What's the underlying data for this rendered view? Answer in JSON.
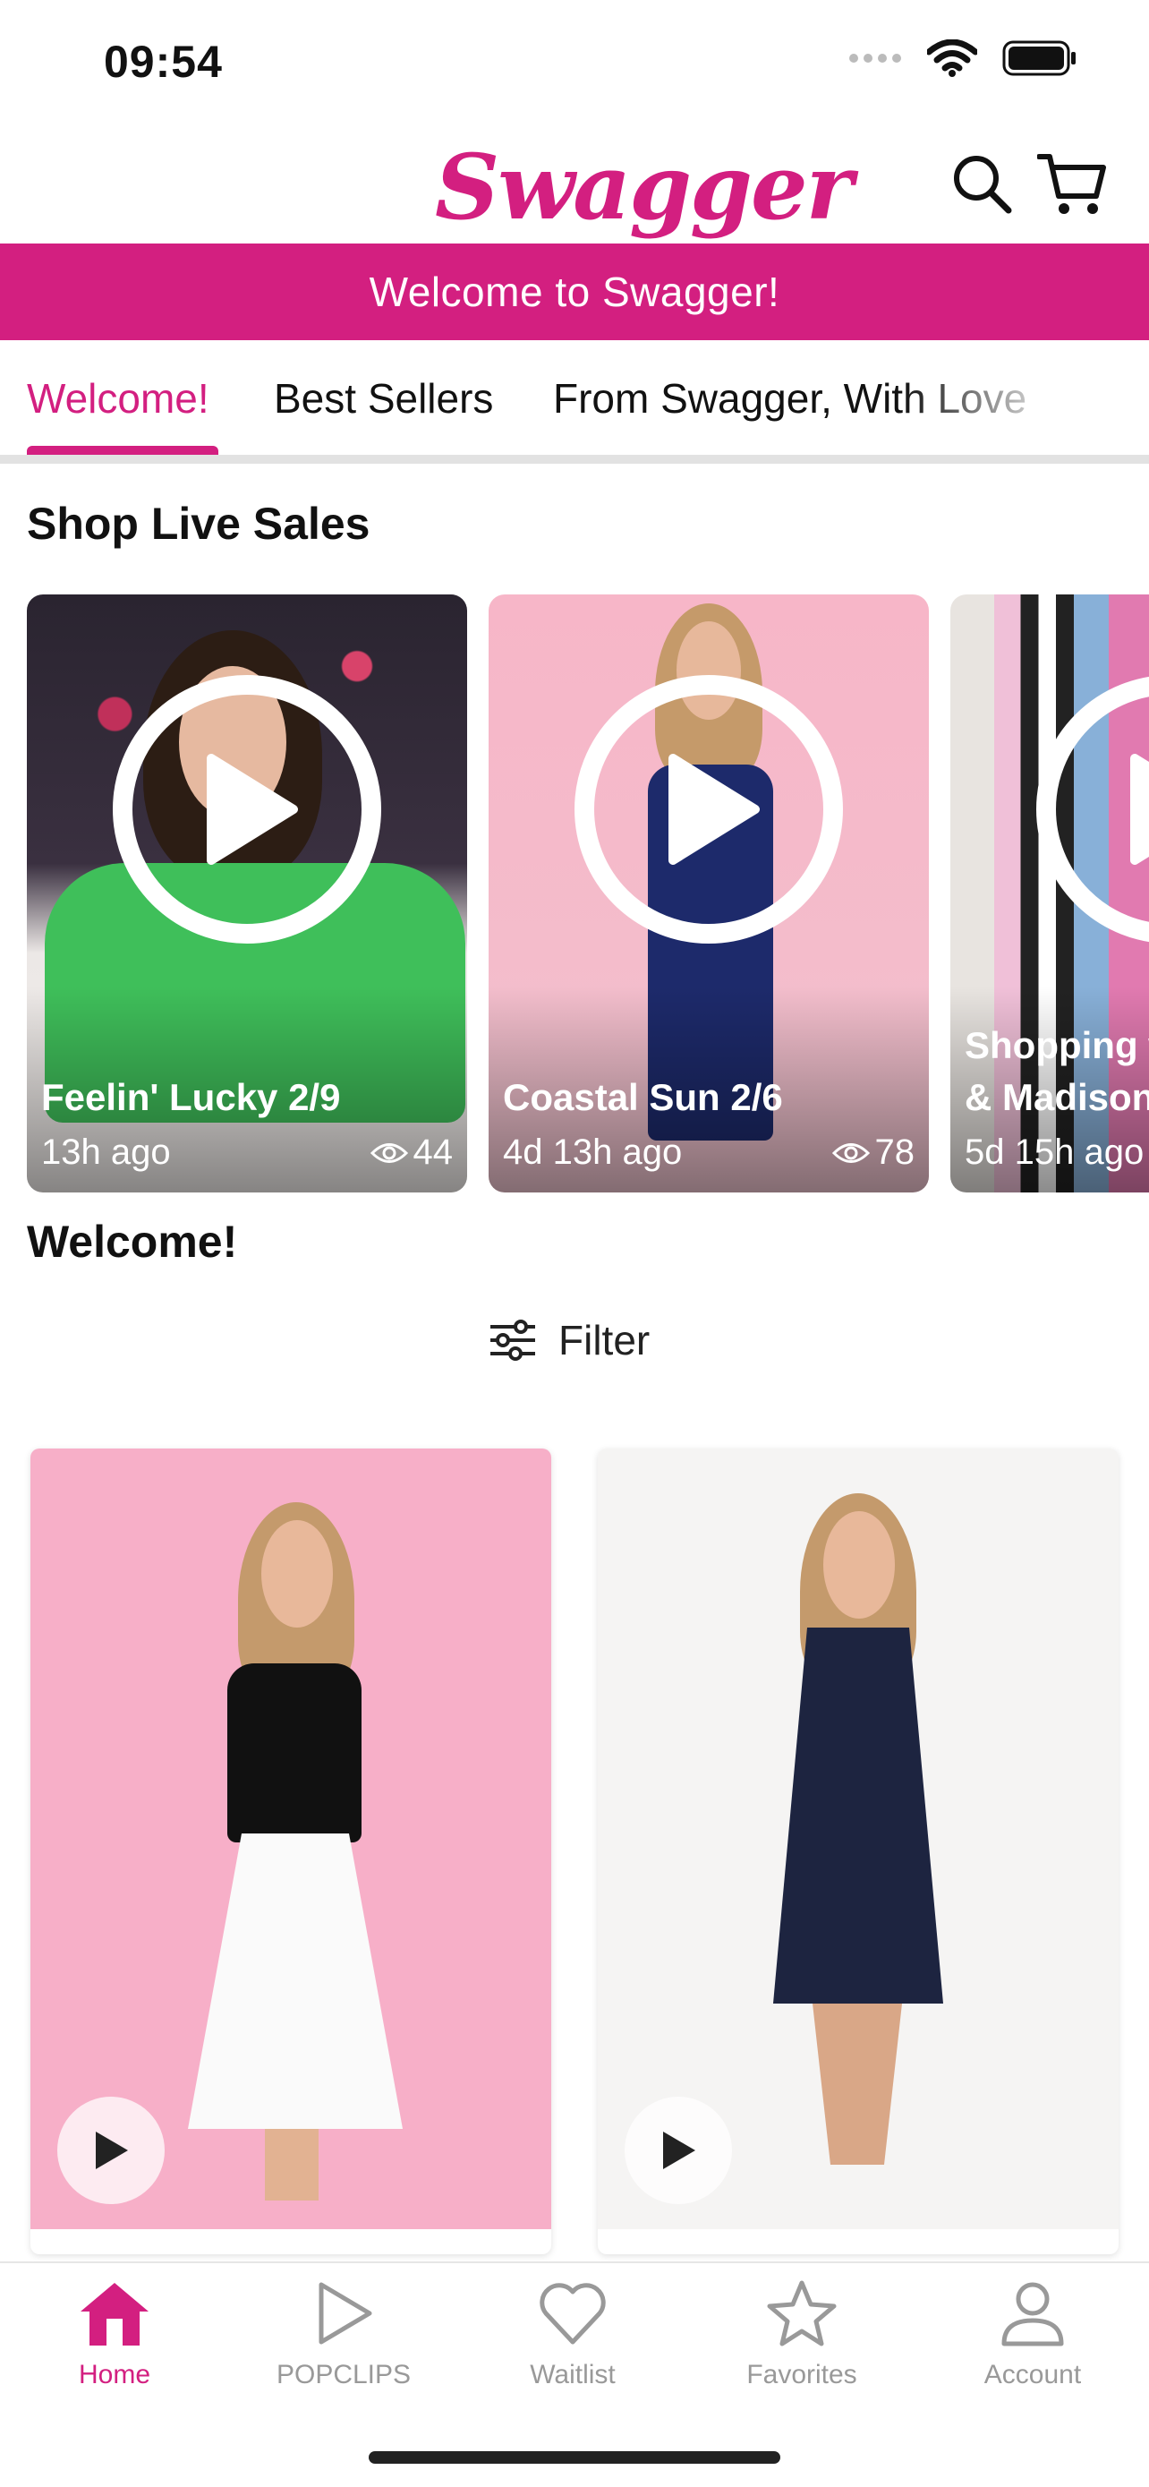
{
  "status": {
    "time": "09:54"
  },
  "header": {
    "logo": "Swagger"
  },
  "banner": {
    "text": "Welcome to Swagger!"
  },
  "tabs": [
    {
      "label": "Welcome!"
    },
    {
      "label": "Best Sellers"
    },
    {
      "label": "From Swagger, With Love"
    }
  ],
  "live_section": {
    "title": "Shop Live Sales",
    "cards": [
      {
        "title": "Feelin' Lucky 2/9",
        "ago": "13h ago",
        "views": "44"
      },
      {
        "title": "Coastal Sun 2/6",
        "ago": "4d 13h ago",
        "views": "78"
      },
      {
        "title": "Shopping w",
        "title_line2": "& Madison",
        "ago": "5d 15h ago"
      }
    ]
  },
  "welcome_section": {
    "title": "Welcome!"
  },
  "filter": {
    "label": "Filter",
    "icon": "sliders-icon"
  },
  "products": [
    {
      "icon": "play-icon"
    },
    {
      "icon": "play-icon"
    }
  ],
  "bottom_nav": [
    {
      "label": "Home",
      "icon": "home-icon"
    },
    {
      "label": "POPCLIPS",
      "icon": "play-outline-icon"
    },
    {
      "label": "Waitlist",
      "icon": "heart-icon"
    },
    {
      "label": "Favorites",
      "icon": "star-icon"
    },
    {
      "label": "Account",
      "icon": "user-icon"
    }
  ],
  "colors": {
    "brand": "#d31f80",
    "inactive": "#999999"
  }
}
